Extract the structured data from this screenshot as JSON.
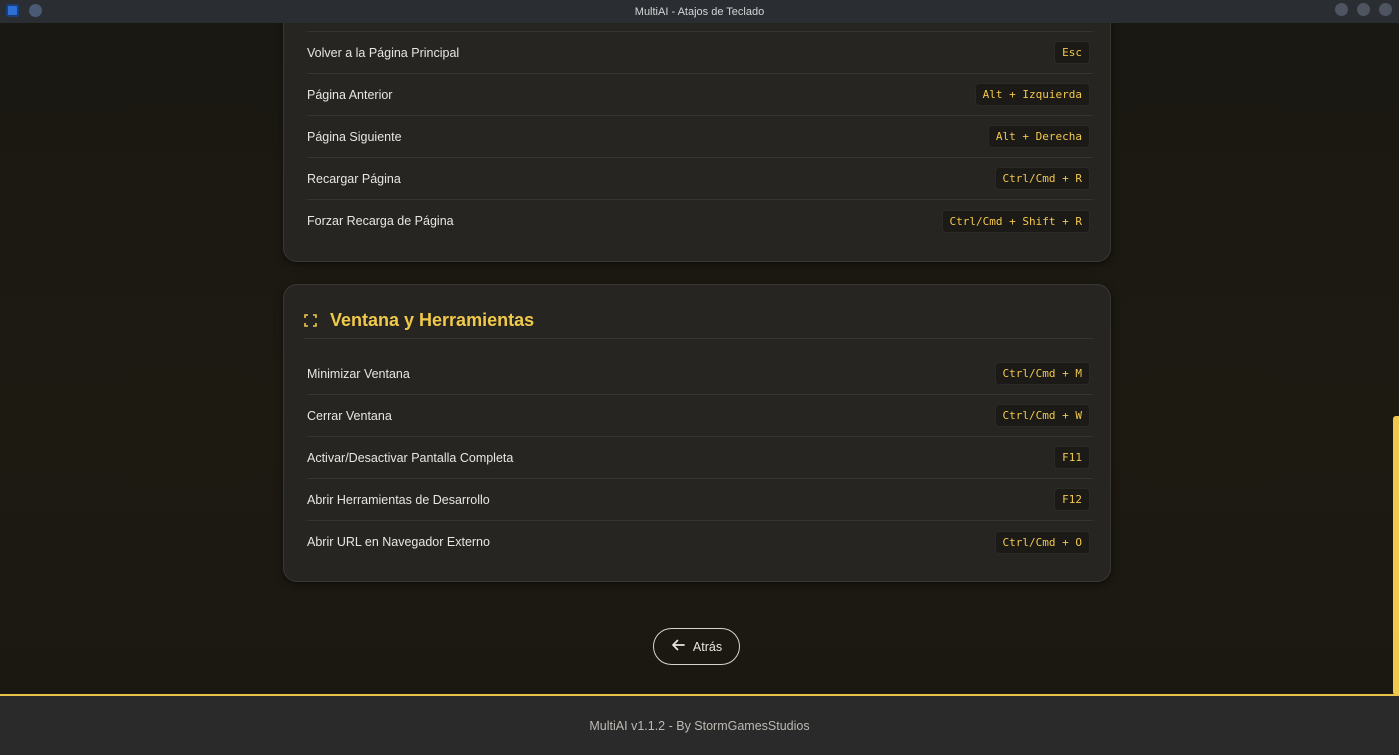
{
  "window": {
    "title": "MultiAI - Atajos de Teclado"
  },
  "navigation_section": {
    "shortcuts": [
      {
        "action": "Volver a la Página Principal",
        "keys": "Esc"
      },
      {
        "action": "Página Anterior",
        "keys": "Alt + Izquierda"
      },
      {
        "action": "Página Siguiente",
        "keys": "Alt + Derecha"
      },
      {
        "action": "Recargar Página",
        "keys": "Ctrl/Cmd + R"
      },
      {
        "action": "Forzar Recarga de Página",
        "keys": "Ctrl/Cmd + Shift + R"
      }
    ]
  },
  "window_section": {
    "title": "Ventana y Herramientas",
    "icon": "fullscreen-icon",
    "shortcuts": [
      {
        "action": "Minimizar Ventana",
        "keys": "Ctrl/Cmd + M"
      },
      {
        "action": "Cerrar Ventana",
        "keys": "Ctrl/Cmd + W"
      },
      {
        "action": "Activar/Desactivar Pantalla Completa",
        "keys": "F11"
      },
      {
        "action": "Abrir Herramientas de Desarrollo",
        "keys": "F12"
      },
      {
        "action": "Abrir URL en Navegador Externo",
        "keys": "Ctrl/Cmd + O"
      }
    ]
  },
  "back_button": {
    "label": "Atrás",
    "icon": "arrow-left-icon"
  },
  "footer": {
    "text": "MultiAI v1.1.2 - By StormGamesStudios"
  },
  "colors": {
    "accent": "#f0c94a",
    "background": "#1a1812",
    "card": "#262522",
    "footer": "#2a2a2a"
  }
}
